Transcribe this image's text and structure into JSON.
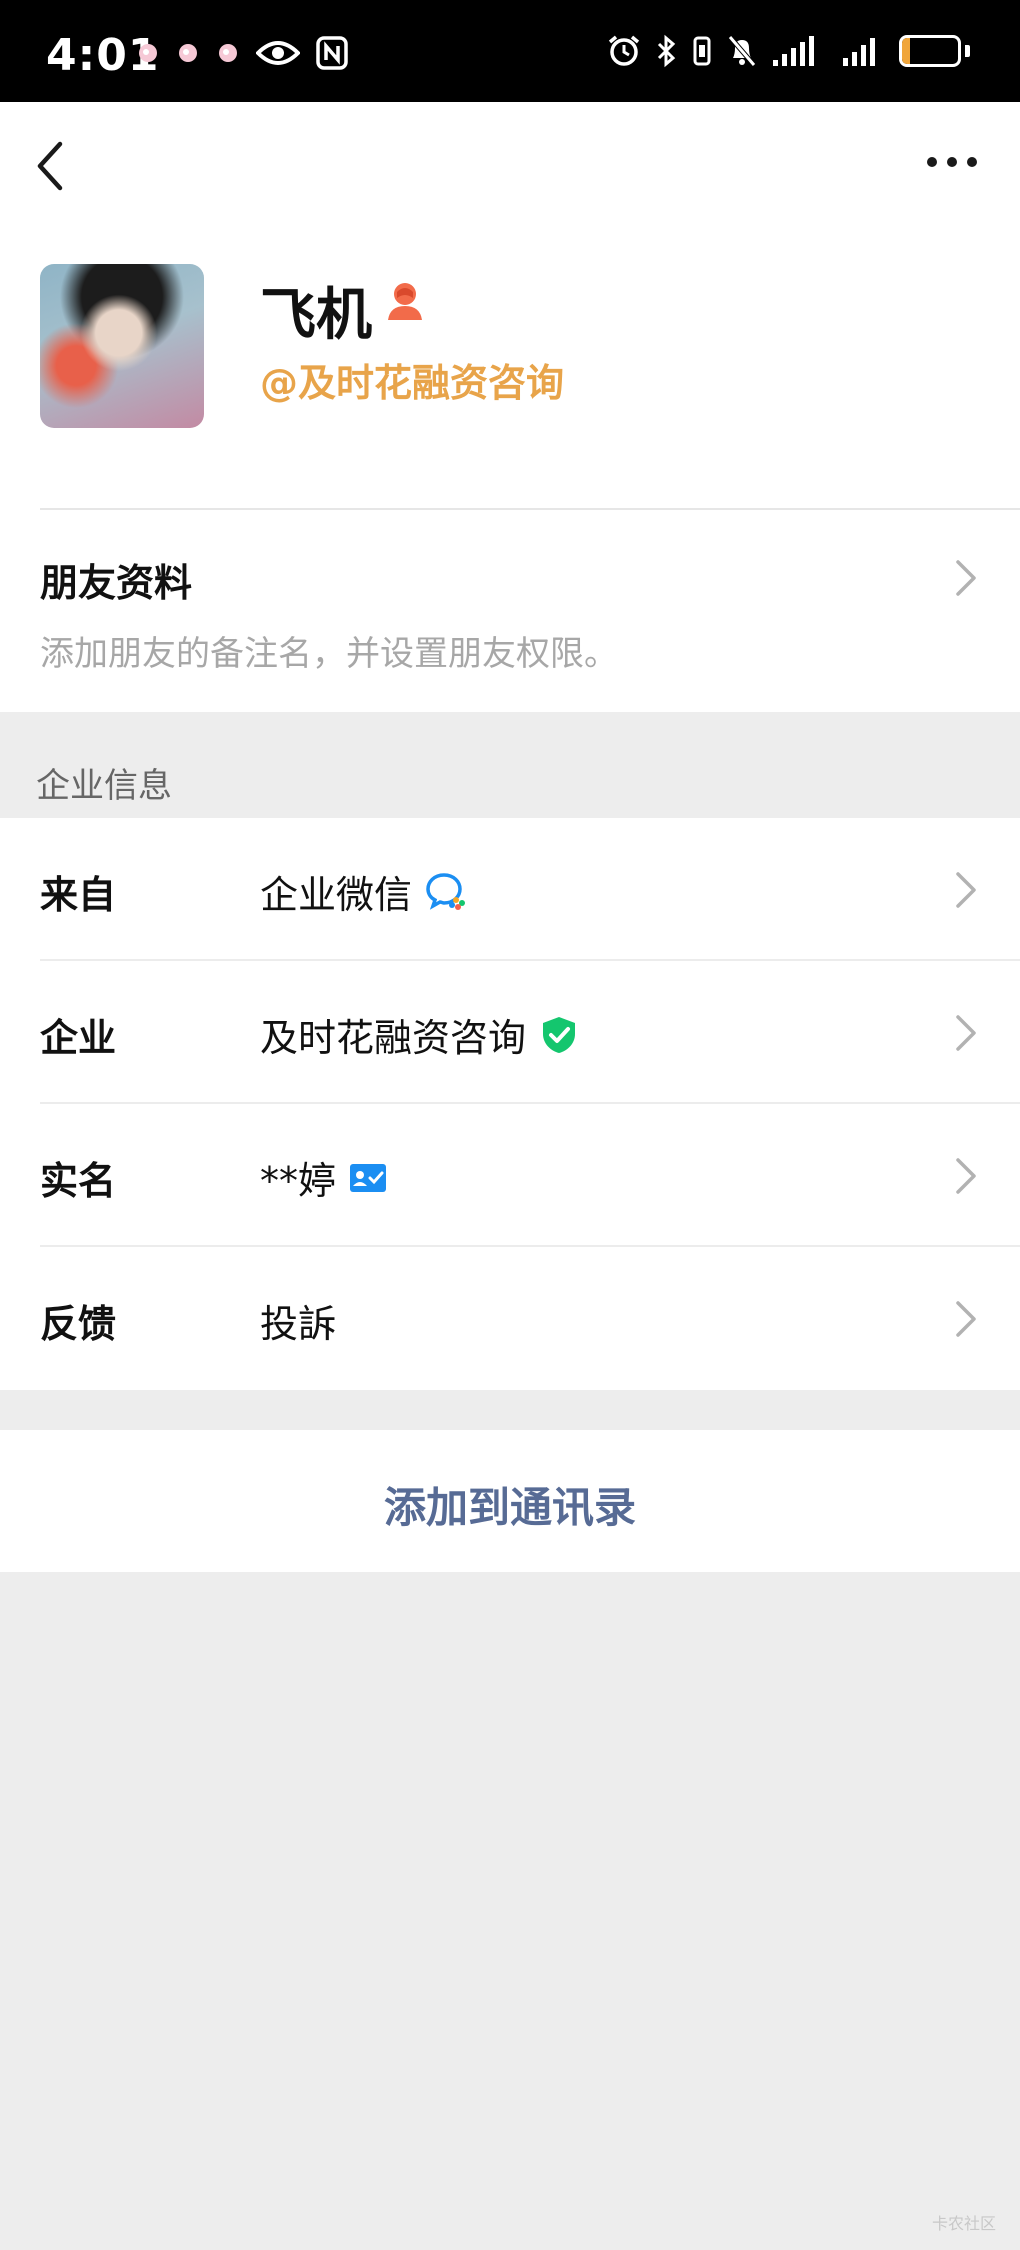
{
  "status_bar": {
    "time": "4:01",
    "battery_level": "15",
    "battery_fraction": 0.15,
    "left_icons": [
      "notification-icon",
      "notification-icon",
      "notification-icon",
      "eye-icon",
      "nfc-icon"
    ],
    "right_icons": [
      "alarm-icon",
      "bluetooth-icon",
      "vibrate-icon",
      "mute-icon",
      "signal-icon",
      "signal-icon",
      "battery-icon"
    ]
  },
  "header": {
    "name": "飞机",
    "corp_handle": "@及时花融资咨询"
  },
  "friend_profile": {
    "title": "朋友资料",
    "description": "添加朋友的备注名，并设置朋友权限。"
  },
  "section": {
    "title": "企业信息"
  },
  "info_rows": [
    {
      "key": "来自",
      "value": "企业微信"
    },
    {
      "key": "企业",
      "value": "及时花融资咨询"
    },
    {
      "key": "实名",
      "value": "**婷"
    },
    {
      "key": "反馈",
      "value": "投訴"
    }
  ],
  "actions": {
    "add_to_contacts": "添加到通讯录"
  },
  "watermark": "卡农社区",
  "colors": {
    "accent_orange": "#e8a44a",
    "link_blue": "#576b95",
    "verified_green": "#14c66e",
    "badge_blue": "#1b8ef2",
    "battery": "#f0a63b"
  }
}
